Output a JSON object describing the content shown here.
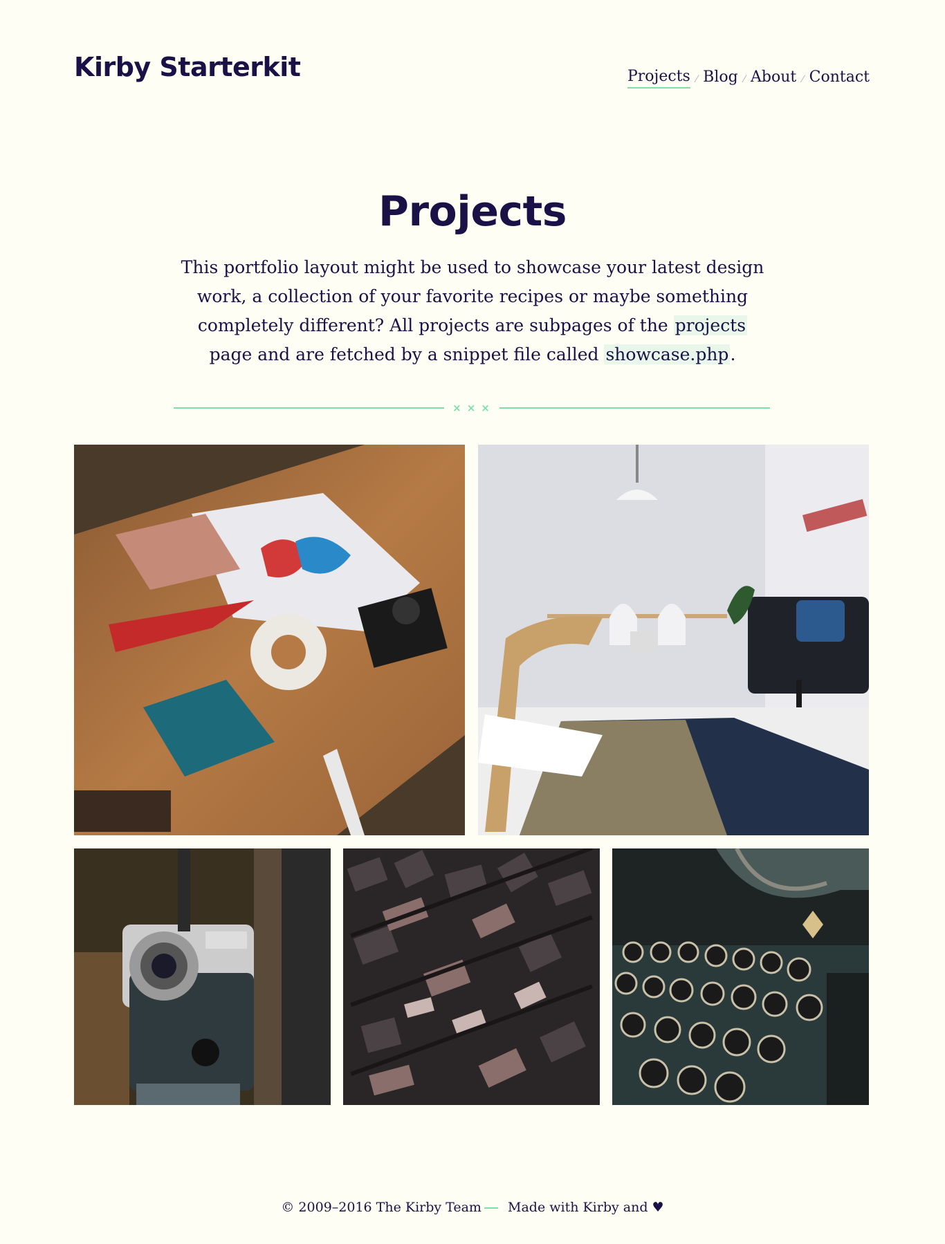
{
  "site": {
    "logo": "Kirby Starterkit"
  },
  "nav": {
    "items": [
      {
        "label": "Projects"
      },
      {
        "label": "Blog"
      },
      {
        "label": "About"
      },
      {
        "label": "Contact"
      }
    ],
    "separator": "⁄"
  },
  "intro": {
    "title": "Projects",
    "text_before": "This portfolio layout might be used to showcase your latest design work, a collection of your favorite recipes or maybe something completely different? All projects are subpages of the ",
    "link1": "projects",
    "text_middle": " page and are fetched by a snippet file called ",
    "link2": "showcase.php",
    "text_after": "."
  },
  "divider": {
    "marks": "×××"
  },
  "projects": [
    {
      "icon": "desk-flatlay-photo"
    },
    {
      "icon": "living-room-photo"
    },
    {
      "icon": "camera-photo"
    },
    {
      "icon": "letterpress-type-photo"
    },
    {
      "icon": "typewriter-photo"
    }
  ],
  "footer": {
    "copyright": "© 2009–2016 The Kirby Team",
    "made_with": "Made with Kirby and",
    "heart": "♥"
  },
  "colors": {
    "background": "#fefef5",
    "text": "#1a1247",
    "accent": "#7ee0a6",
    "highlight": "#e8f7ea"
  }
}
